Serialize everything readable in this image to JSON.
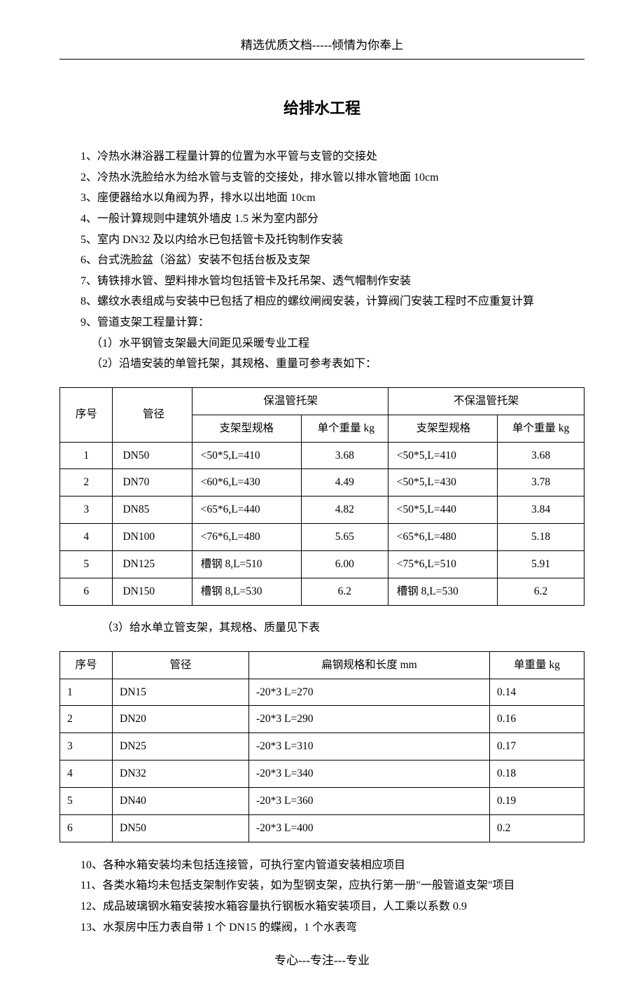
{
  "header": "精选优质文档-----倾情为你奉上",
  "title": "给排水工程",
  "list1": [
    "1、冷热水淋浴器工程量计算的位置为水平管与支管的交接处",
    "2、冷热水洗脸给水为给水管与支管的交接处，排水管以排水管地面 10cm",
    "3、座便器给水以角阀为界，排水以出地面 10cm",
    "4、一般计算规则中建筑外墙皮 1.5 米为室内部分",
    "5、室内 DN32 及以内给水已包括管卡及托钩制作安装",
    "6、台式洗脸盆（浴盆）安装不包括台板及支架",
    "7、铸铁排水管、塑料排水管均包括管卡及托吊架、透气帽制作安装",
    "8、螺纹水表组成与安装中已包括了相应的螺纹闸阀安装，计算阀门安装工程时不应重复计算",
    "9、管道支架工程量计算："
  ],
  "sublist1": [
    "（1）水平钢管支架最大间距见采暖专业工程",
    "（2）沿墙安装的单管托架，其规格、重量可参考表如下："
  ],
  "table1": {
    "header": {
      "col1": "序号",
      "col2": "管径",
      "col3": "保温管托架",
      "col4": "不保温管托架",
      "sub1": "支架型规格",
      "sub2": "单个重量 kg",
      "sub3": "支架型规格",
      "sub4": "单个重量 kg"
    },
    "rows": [
      {
        "n": "1",
        "d": "DN50",
        "a": "<50*5,L=410",
        "b": "3.68",
        "c": "<50*5,L=410",
        "e": "3.68"
      },
      {
        "n": "2",
        "d": "DN70",
        "a": "<60*6,L=430",
        "b": "4.49",
        "c": "<50*5,L=430",
        "e": "3.78"
      },
      {
        "n": "3",
        "d": "DN85",
        "a": "<65*6,L=440",
        "b": "4.82",
        "c": "<50*5,L=440",
        "e": "3.84"
      },
      {
        "n": "4",
        "d": "DN100",
        "a": "<76*6,L=480",
        "b": "5.65",
        "c": "<65*6,L=480",
        "e": "5.18"
      },
      {
        "n": "5",
        "d": "DN125",
        "a": "槽钢  8,L=510",
        "b": "6.00",
        "c": "<75*6,L=510",
        "e": "5.91"
      },
      {
        "n": "6",
        "d": "DN150",
        "a": "槽钢  8,L=530",
        "b": "6.2",
        "c": "槽钢  8,L=530",
        "e": "6.2"
      }
    ]
  },
  "intertext": "（3）给水单立管支架，其规格、质量见下表",
  "table2": {
    "header": {
      "col1": "序号",
      "col2": "管径",
      "col3": "扁钢规格和长度 mm",
      "col4": "单重量 kg"
    },
    "rows": [
      {
        "n": "1",
        "d": "DN15",
        "s": "-20*3    L=270",
        "w": "0.14"
      },
      {
        "n": "2",
        "d": "DN20",
        "s": "-20*3    L=290",
        "w": "0.16"
      },
      {
        "n": "3",
        "d": "DN25",
        "s": "-20*3    L=310",
        "w": "0.17"
      },
      {
        "n": "4",
        "d": "DN32",
        "s": "-20*3    L=340",
        "w": "0.18"
      },
      {
        "n": "5",
        "d": "DN40",
        "s": "-20*3    L=360",
        "w": "0.19"
      },
      {
        "n": "6",
        "d": "DN50",
        "s": "-20*3    L=400",
        "w": "0.2"
      }
    ]
  },
  "list2": [
    "10、各种水箱安装均未包括连接管，可执行室内管道安装相应项目",
    "11、各类水箱均未包括支架制作安装，如为型钢支架，应执行第一册\"一般管道支架\"项目",
    "12、成品玻璃钢水箱安装按水箱容量执行钢板水箱安装项目，人工乘以系数 0.9",
    "13、水泵房中压力表自带 1 个 DN15 的蝶阀，1 个水表弯"
  ],
  "footer": "专心---专注---专业"
}
